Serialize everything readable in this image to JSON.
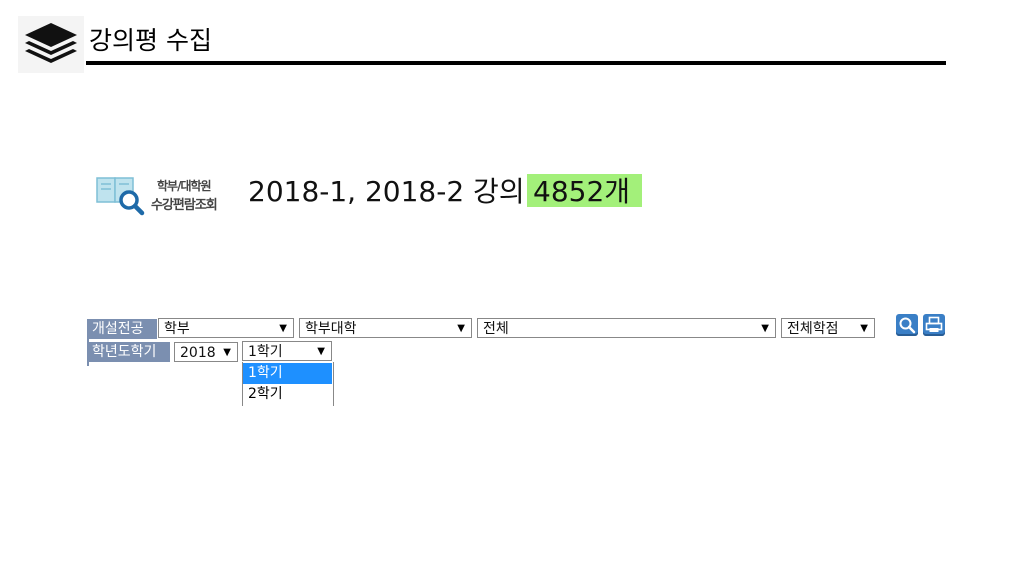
{
  "header": {
    "title": "강의평 수집"
  },
  "brand": {
    "line1": "학부/대학원",
    "line2": "수강편람조회"
  },
  "hero": {
    "headline": "2018-1, 2018-2 강의",
    "count": "4852개"
  },
  "form": {
    "labels": {
      "department": "개설전공",
      "year_term": "학년도학기"
    },
    "selects": {
      "level": "학부",
      "college": "학부대학",
      "major": "전체",
      "credit": "전체학점",
      "year": "2018",
      "term": "1학기"
    },
    "arrow": "▼",
    "term_options": [
      "1학기",
      "2학기"
    ]
  },
  "colors": {
    "count_highlight": "#a3f07a",
    "label_bg": "#7b8fb0",
    "selected_option": "#1e90ff",
    "button_blue": "#3a7fc6"
  },
  "icons": {
    "logo": "stacked-layers-icon",
    "brand": "book-magnifier-icon",
    "search": "magnifier-icon",
    "print": "printer-icon"
  }
}
